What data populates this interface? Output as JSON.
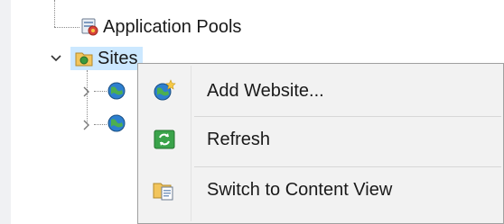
{
  "tree": {
    "items": [
      {
        "label": "Application Pools",
        "icon": "app-pools-icon"
      },
      {
        "label": "Sites",
        "icon": "sites-folder-icon",
        "expanded": true,
        "selected": true
      },
      {
        "label": "",
        "icon": "globe-icon",
        "expanded": false
      },
      {
        "label": "",
        "icon": "globe-icon",
        "expanded": false
      }
    ]
  },
  "context_menu": {
    "items": [
      {
        "label": "Add Website...",
        "icon": "add-website-icon"
      },
      {
        "label": "Refresh",
        "icon": "refresh-icon"
      },
      {
        "label": "Switch to Content View",
        "icon": "content-view-icon"
      }
    ]
  },
  "colors": {
    "selection": "#cce8ff",
    "menu_bg": "#f2f2f2",
    "menu_border": "#a0a0a0",
    "panel_bg": "#ffffff",
    "frame_bg": "#f0f1f3"
  }
}
